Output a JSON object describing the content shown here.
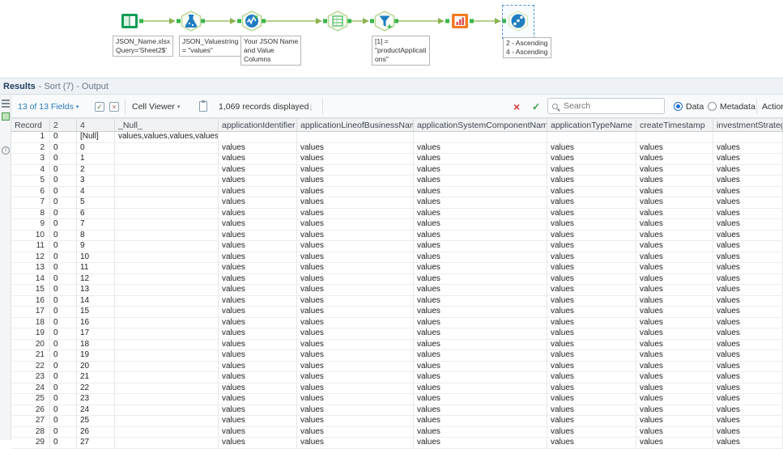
{
  "colors": {
    "wire_green": "#8ab34f",
    "anchor_green": "#39b54a",
    "link_blue": "#2b7bbf",
    "error_red": "#d23b3b",
    "ok_green": "#2da044"
  },
  "canvas": {
    "annotations": {
      "input": "JSON_Name.xlsx\nQuery='Sheet2$'",
      "json_parse": "JSON_Valuestring\n= \"values\"",
      "columns_note": "Your JSON Name\nand Value\nColumns",
      "filter": "[1] =\n\"productApplicati\nons\"",
      "sort": "2 - Ascending\n4 - Ascending"
    }
  },
  "results": {
    "title": "Results",
    "subtitle": "- Sort (7) - Output",
    "toolbar": {
      "fields_label": "13 of 13 Fields",
      "cell_viewer_label": "Cell Viewer",
      "records_label": "1,069 records displayed",
      "search_placeholder": "Search",
      "data_label": "Data",
      "metadata_label": "Metadata",
      "actions_label": "Actions"
    },
    "table": {
      "columns": [
        "Record",
        "2",
        "4",
        "_Null_",
        "applicationIdentifier",
        "applicationLineofBusinessName",
        "applicationSystemComponentName",
        "applicationTypeName",
        "createTimestamp",
        "investmentStrategyNam"
      ],
      "rows": [
        [
          "1",
          "0",
          "[Null]",
          "values,values,values,values",
          "",
          "",
          "",
          "",
          "",
          ""
        ],
        [
          "2",
          "0",
          "0",
          "",
          "values",
          "values",
          "values",
          "values",
          "values",
          "values"
        ],
        [
          "3",
          "0",
          "1",
          "",
          "values",
          "values",
          "values",
          "values",
          "values",
          "values"
        ],
        [
          "4",
          "0",
          "2",
          "",
          "values",
          "values",
          "values",
          "values",
          "values",
          "values"
        ],
        [
          "5",
          "0",
          "3",
          "",
          "values",
          "values",
          "values",
          "values",
          "values",
          "values"
        ],
        [
          "6",
          "0",
          "4",
          "",
          "values",
          "values",
          "values",
          "values",
          "values",
          "values"
        ],
        [
          "7",
          "0",
          "5",
          "",
          "values",
          "values",
          "values",
          "values",
          "values",
          "values"
        ],
        [
          "8",
          "0",
          "6",
          "",
          "values",
          "values",
          "values",
          "values",
          "values",
          "values"
        ],
        [
          "9",
          "0",
          "7",
          "",
          "values",
          "values",
          "values",
          "values",
          "values",
          "values"
        ],
        [
          "10",
          "0",
          "8",
          "",
          "values",
          "values",
          "values",
          "values",
          "values",
          "values"
        ],
        [
          "11",
          "0",
          "9",
          "",
          "values",
          "values",
          "values",
          "values",
          "values",
          "values"
        ],
        [
          "12",
          "0",
          "10",
          "",
          "values",
          "values",
          "values",
          "values",
          "values",
          "values"
        ],
        [
          "13",
          "0",
          "11",
          "",
          "values",
          "values",
          "values",
          "values",
          "values",
          "values"
        ],
        [
          "14",
          "0",
          "12",
          "",
          "values",
          "values",
          "values",
          "values",
          "values",
          "values"
        ],
        [
          "15",
          "0",
          "13",
          "",
          "values",
          "values",
          "values",
          "values",
          "values",
          "values"
        ],
        [
          "16",
          "0",
          "14",
          "",
          "values",
          "values",
          "values",
          "values",
          "values",
          "values"
        ],
        [
          "17",
          "0",
          "15",
          "",
          "values",
          "values",
          "values",
          "values",
          "values",
          "values"
        ],
        [
          "18",
          "0",
          "16",
          "",
          "values",
          "values",
          "values",
          "values",
          "values",
          "values"
        ],
        [
          "19",
          "0",
          "17",
          "",
          "values",
          "values",
          "values",
          "values",
          "values",
          "values"
        ],
        [
          "20",
          "0",
          "18",
          "",
          "values",
          "values",
          "values",
          "values",
          "values",
          "values"
        ],
        [
          "21",
          "0",
          "19",
          "",
          "values",
          "values",
          "values",
          "values",
          "values",
          "values"
        ],
        [
          "22",
          "0",
          "20",
          "",
          "values",
          "values",
          "values",
          "values",
          "values",
          "values"
        ],
        [
          "23",
          "0",
          "21",
          "",
          "values",
          "values",
          "values",
          "values",
          "values",
          "values"
        ],
        [
          "24",
          "0",
          "22",
          "",
          "values",
          "values",
          "values",
          "values",
          "values",
          "values"
        ],
        [
          "25",
          "0",
          "23",
          "",
          "values",
          "values",
          "values",
          "values",
          "values",
          "values"
        ],
        [
          "26",
          "0",
          "24",
          "",
          "values",
          "values",
          "values",
          "values",
          "values",
          "values"
        ],
        [
          "27",
          "0",
          "25",
          "",
          "values",
          "values",
          "values",
          "values",
          "values",
          "values"
        ],
        [
          "28",
          "0",
          "26",
          "",
          "values",
          "values",
          "values",
          "values",
          "values",
          "values"
        ],
        [
          "29",
          "0",
          "27",
          "",
          "values",
          "values",
          "values",
          "values",
          "values",
          "values"
        ]
      ]
    }
  }
}
